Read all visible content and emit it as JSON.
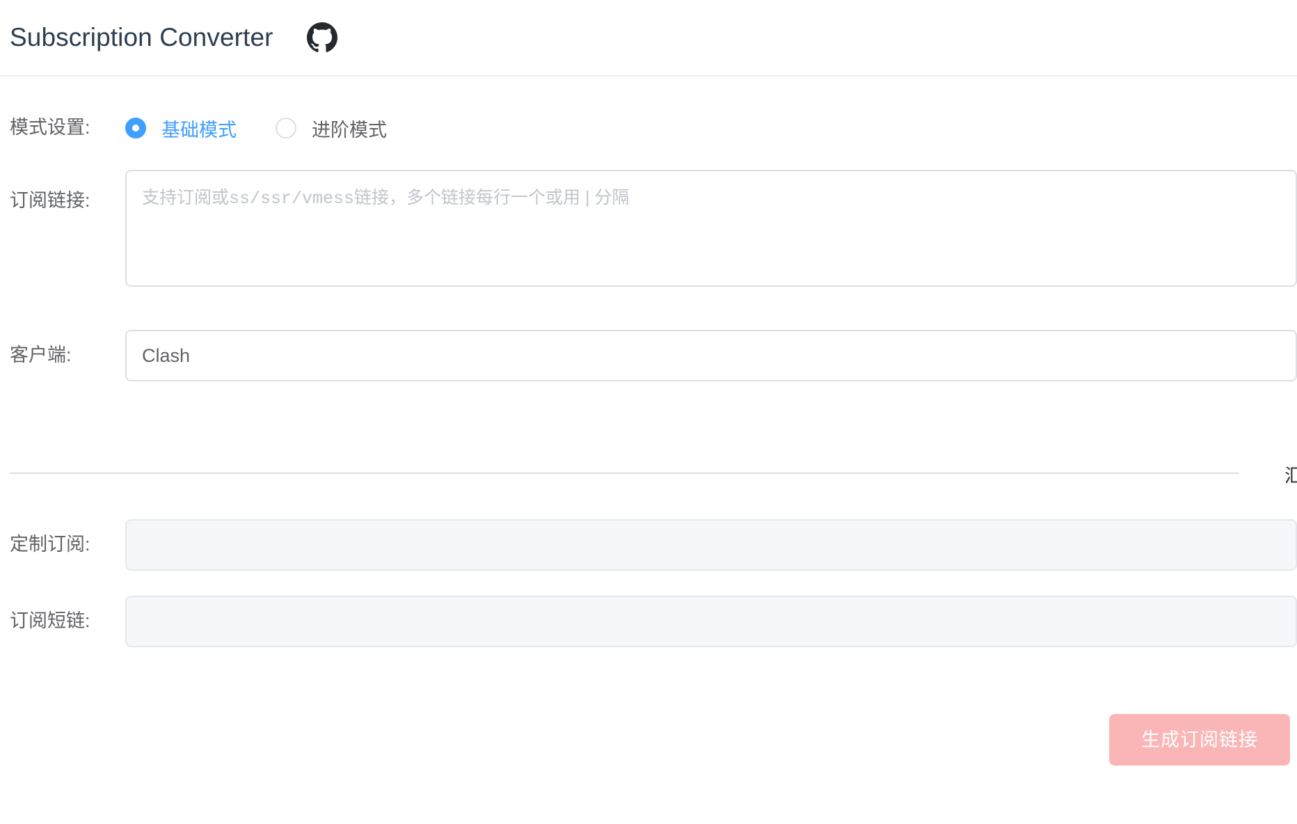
{
  "header": {
    "title": "Subscription Converter",
    "github_icon": "github-icon"
  },
  "form": {
    "mode": {
      "label": "模式设置:",
      "options": [
        {
          "label": "基础模式",
          "selected": true
        },
        {
          "label": "进阶模式",
          "selected": false
        }
      ]
    },
    "subscription_links": {
      "label": "订阅链接:",
      "value": "",
      "placeholder_parts": {
        "p1": "支持订阅或",
        "p2": "ss/ssr/vmess",
        "p3": "链接，多个链接每行一个或用 | 分隔"
      },
      "placeholder": "支持订阅或ss/ssr/vmess链接，多个链接每行一个或用 | 分隔"
    },
    "client": {
      "label": "客户端:",
      "value": "Clash"
    },
    "divider": {
      "text": "汇"
    },
    "custom_subscription": {
      "label": "定制订阅:",
      "value": ""
    },
    "short_link": {
      "label": "订阅短链:",
      "value": ""
    },
    "submit": {
      "label": "生成订阅链接"
    }
  },
  "colors": {
    "accent": "#409eff",
    "button": "#fab6b6",
    "border": "#dcdfe6",
    "label_text": "#606266",
    "disabled_bg": "#f5f7fa"
  }
}
